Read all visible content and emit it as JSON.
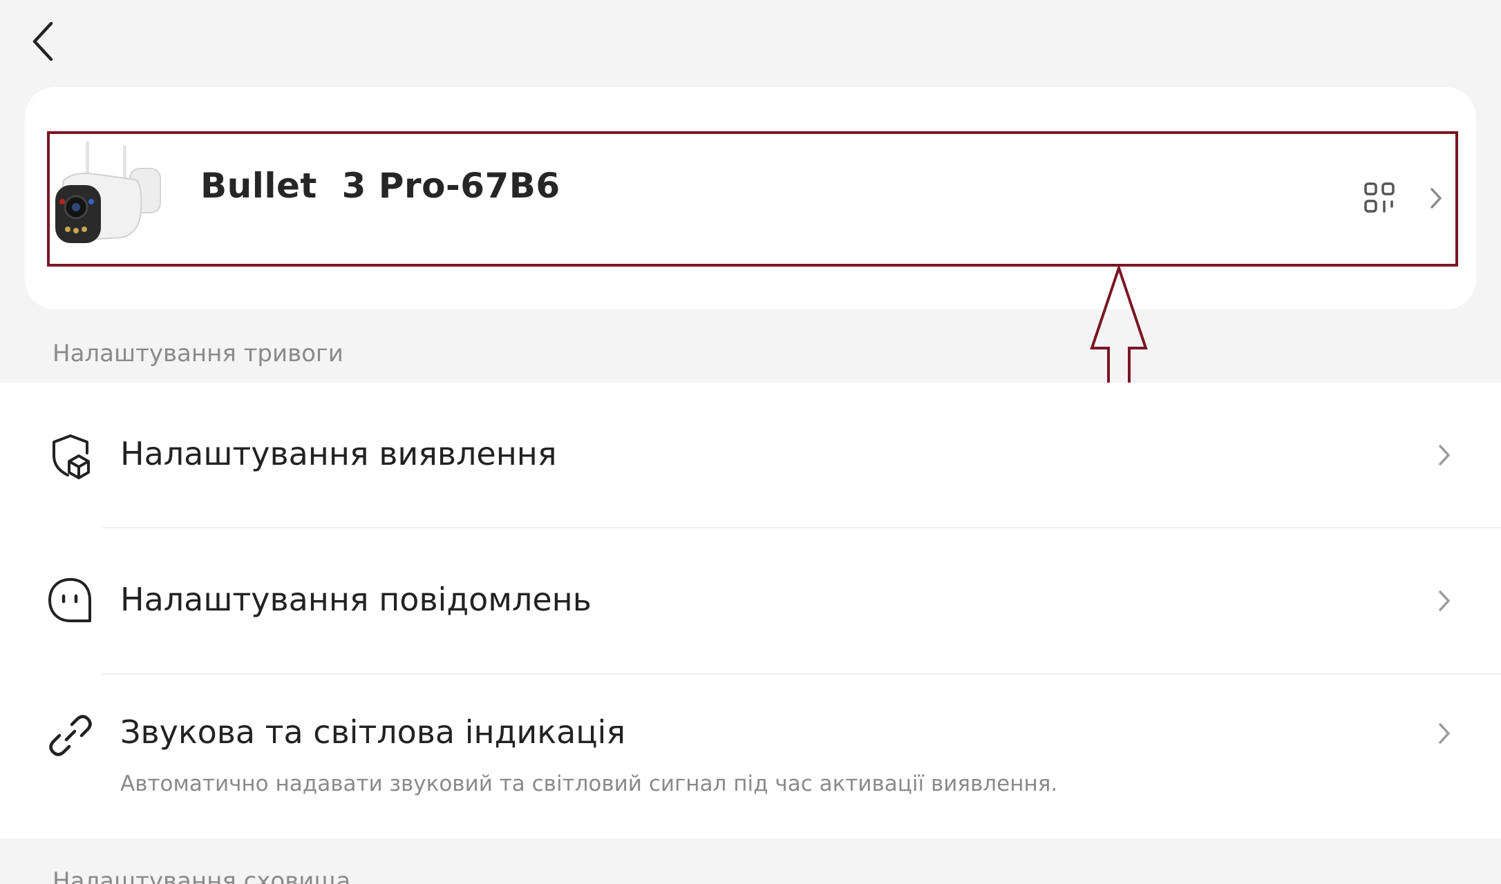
{
  "nav": {
    "back_icon": "chevron-left-icon"
  },
  "device": {
    "name": "Bullet  3 Pro-67B6",
    "thumbnail": "bullet-camera-image",
    "qr_icon": "qr-code-icon",
    "chevron_icon": "chevron-right-icon"
  },
  "annotation": {
    "color": "#7a1424"
  },
  "alarm_section": {
    "title": "Налаштування тривоги",
    "items": [
      {
        "label": "Налаштування виявлення",
        "icon": "shield-box-icon"
      },
      {
        "label": "Налаштування повідомлень",
        "icon": "chat-face-icon"
      },
      {
        "label": "Звукова та світлова індикація",
        "description": "Автоматично надавати звуковий та світловий сигнал під час активації виявлення.",
        "icon": "link-icon"
      }
    ]
  },
  "storage_section": {
    "title": "Налаштування сховища"
  }
}
